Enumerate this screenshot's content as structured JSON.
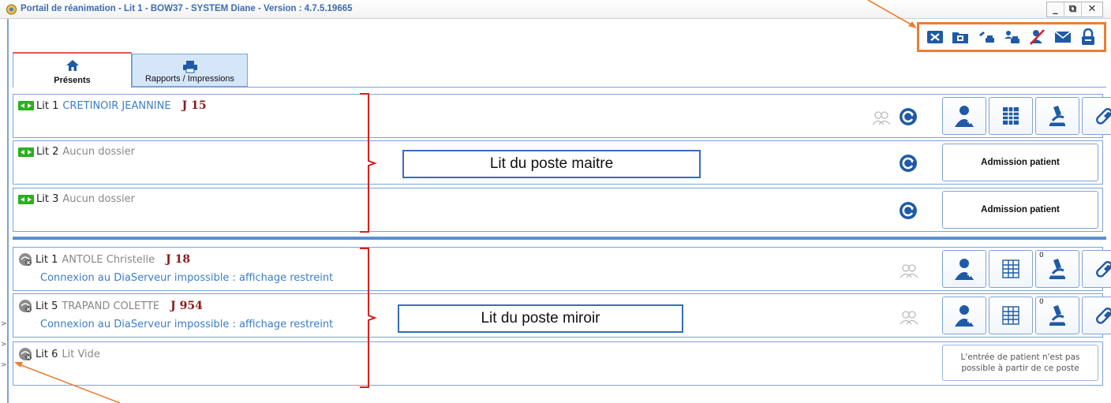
{
  "window": {
    "title": "Portail de réanimation - Lit 1 - BOW37 - SYSTEM Diane - Version : 4.7.5.19665",
    "controls": [
      "_",
      "⧉",
      "✕"
    ]
  },
  "left_markers": [
    ">",
    ">",
    ">"
  ],
  "toolbar": {
    "icons": [
      "close-session-icon",
      "open-folder-icon",
      "print-patient-icon",
      "print-user-icon",
      "logout-user-icon",
      "mail-icon",
      "lock-icon"
    ]
  },
  "tabs": [
    {
      "label": "Présents",
      "icon": "home-icon",
      "active": true
    },
    {
      "label": "Rapports / Impressions",
      "icon": "printer-icon",
      "active": false
    }
  ],
  "master_beds": [
    {
      "lit": "Lit 1",
      "patient": "CRETINOIR JEANNINE",
      "day": "J 15",
      "action": "buttons"
    },
    {
      "lit": "Lit 2",
      "patient": "Aucun dossier",
      "day": "",
      "action": "Admission patient"
    },
    {
      "lit": "Lit 3",
      "patient": "Aucun dossier",
      "day": "",
      "action": "Admission patient"
    }
  ],
  "mirror_beds": [
    {
      "lit": "Lit 1",
      "patient": "ANTOLE Christelle",
      "day": "J 18",
      "message": "Connexion au DiaServeur impossible : affichage restreint",
      "badge": "0"
    },
    {
      "lit": "Lit 5",
      "patient": "TRAPAND COLETTE",
      "day": "J 954",
      "message": "Connexion au DiaServeur impossible : affichage restreint",
      "badge": "0"
    },
    {
      "lit": "Lit 6",
      "patient": "Lit Vide",
      "day": "",
      "action": "L'entrée de patient n'est pas possible à partir de ce poste"
    }
  ],
  "annotations": {
    "master": "Lit du poste maitre",
    "mirror": "Lit du poste miroir"
  },
  "colors": {
    "accent_blue": "#1f5aa6",
    "annotation_orange": "#ed7d31",
    "bracket_red": "#d62020",
    "day_red": "#8b1a1a"
  }
}
